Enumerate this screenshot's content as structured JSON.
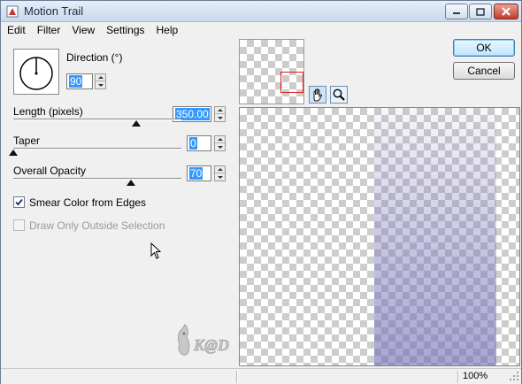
{
  "window": {
    "title": "Motion Trail",
    "controls": {
      "minimize": "minimize",
      "maximize": "maximize",
      "close": "close"
    }
  },
  "menu": [
    "Edit",
    "Filter",
    "View",
    "Settings",
    "Help"
  ],
  "direction": {
    "label": "Direction (°)",
    "value": "90",
    "dial_angle_deg": 90
  },
  "length": {
    "label": "Length (pixels)",
    "value": "350.00",
    "slider_fraction": 0.73
  },
  "taper": {
    "label": "Taper",
    "value": "0",
    "slider_fraction": 0.0
  },
  "opacity": {
    "label": "Overall Opacity",
    "value": "70",
    "slider_fraction": 0.7
  },
  "options": {
    "smear": {
      "label": "Smear Color from Edges",
      "checked": true,
      "enabled": true
    },
    "outside": {
      "label": "Draw Only Outside Selection",
      "checked": false,
      "enabled": false
    }
  },
  "buttons": {
    "ok": "OK",
    "cancel": "Cancel"
  },
  "tools": {
    "pan": "hand-icon",
    "zoom": "magnifier-icon"
  },
  "logo_text": "K@D",
  "status": {
    "zoom": "100%"
  },
  "colors": {
    "smear": "#8f8bc4",
    "nav_rect": "#e02020",
    "selection": "#3399ff"
  }
}
